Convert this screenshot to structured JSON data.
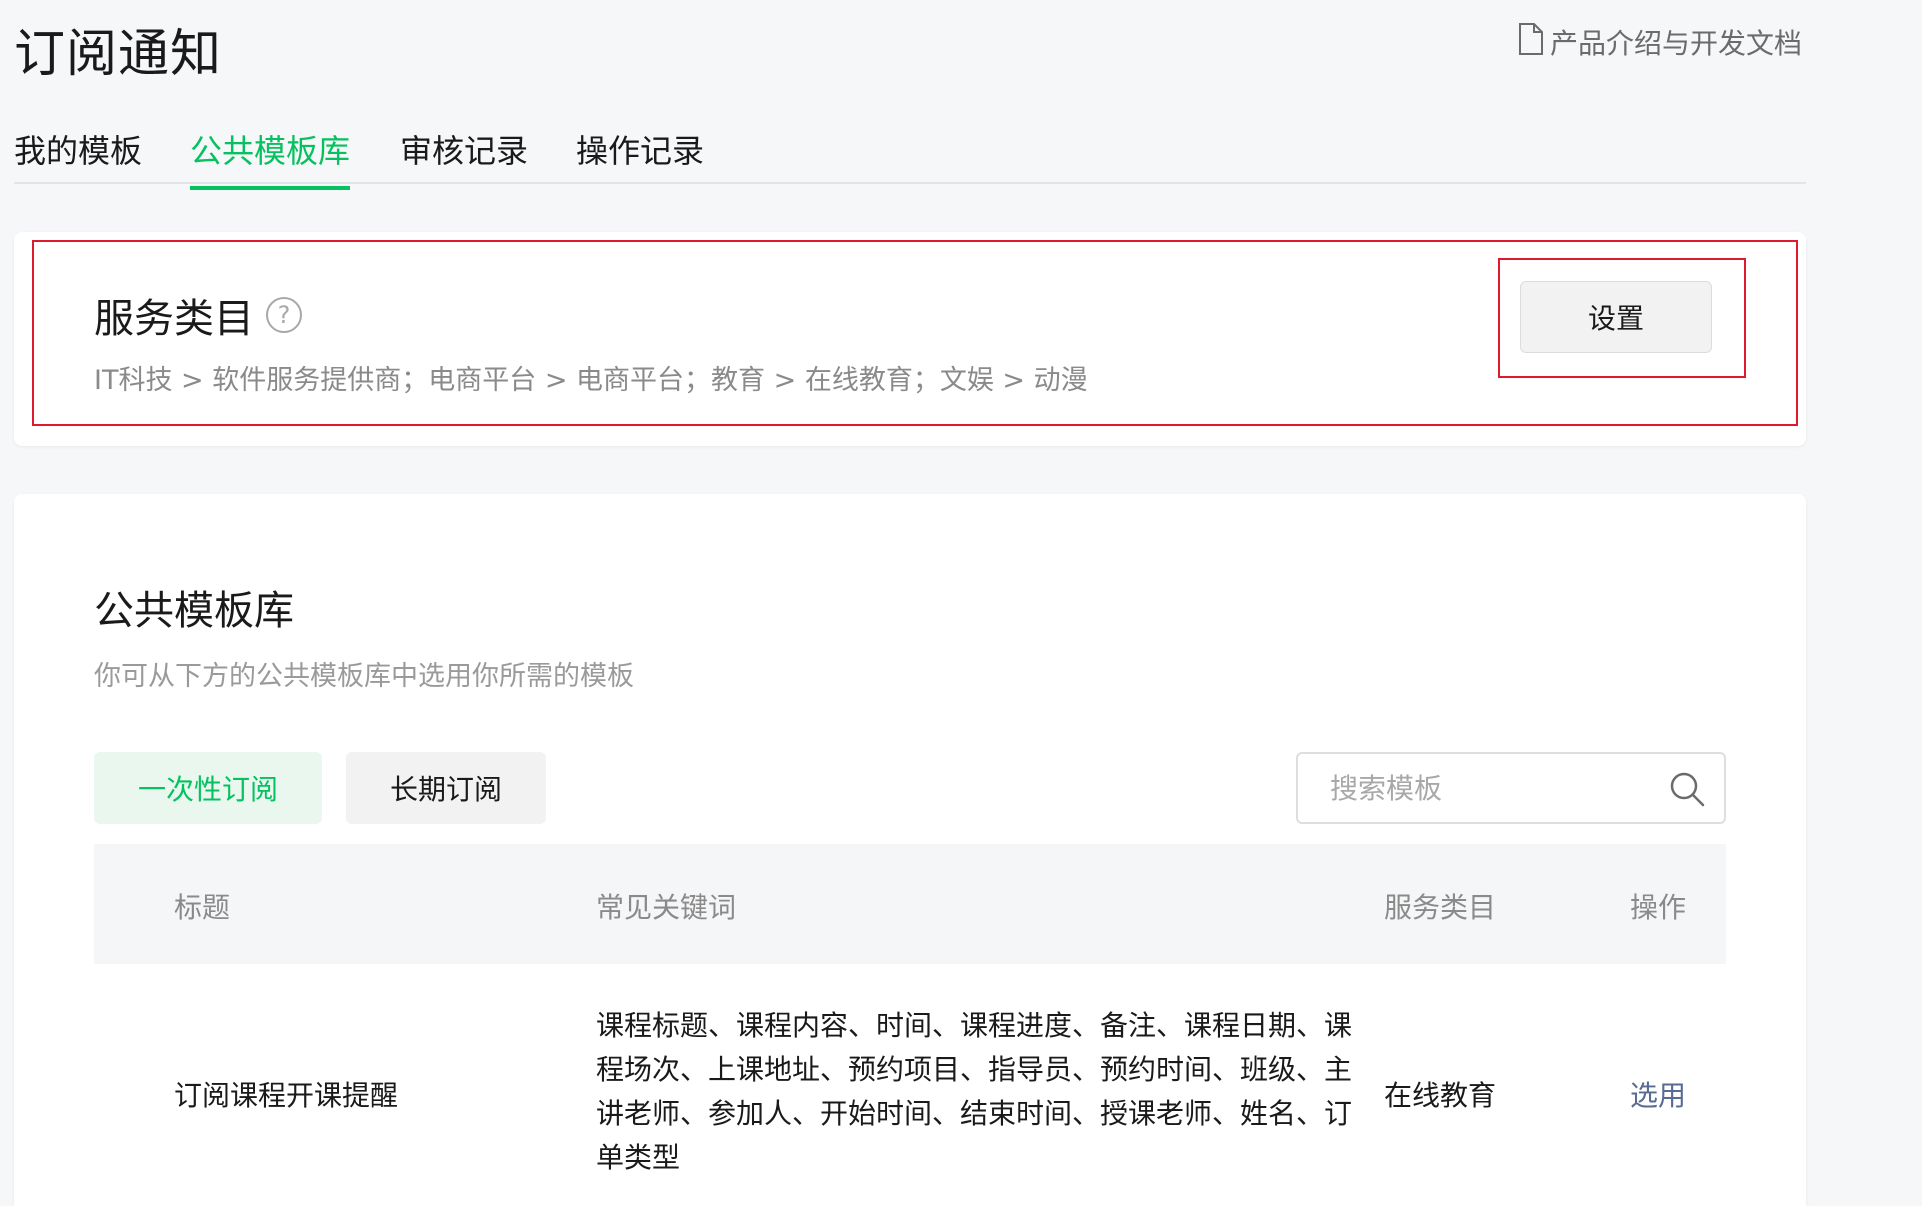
{
  "header": {
    "title": "订阅通知",
    "doc_link": "产品介绍与开发文档"
  },
  "tabs": [
    {
      "label": "我的模板",
      "active": false
    },
    {
      "label": "公共模板库",
      "active": true
    },
    {
      "label": "审核记录",
      "active": false
    },
    {
      "label": "操作记录",
      "active": false
    }
  ],
  "service": {
    "title": "服务类目",
    "help_symbol": "?",
    "path": "IT科技  >  软件服务提供商；电商平台  >  电商平台；教育  >  在线教育；文娱  >  动漫",
    "set_button": "设置"
  },
  "library": {
    "title": "公共模板库",
    "desc": "你可从下方的公共模板库中选用你所需的模板",
    "seg_once": "一次性订阅",
    "seg_long": "长期订阅",
    "search_placeholder": "搜索模板",
    "columns": {
      "title": "标题",
      "keywords": "常见关键词",
      "category": "服务类目",
      "action": "操作"
    },
    "rows": [
      {
        "title": "订阅课程开课提醒",
        "keywords": "课程标题、课程内容、时间、课程进度、备注、课程日期、课程场次、上课地址、预约项目、指导员、预约时间、班级、主讲老师、参加人、开始时间、结束时间、授课老师、姓名、订单类型",
        "category": "在线教育",
        "action": "选用"
      }
    ]
  },
  "colors": {
    "accent": "#07c160",
    "link": "#576b95",
    "highlight": "#e0192e"
  }
}
